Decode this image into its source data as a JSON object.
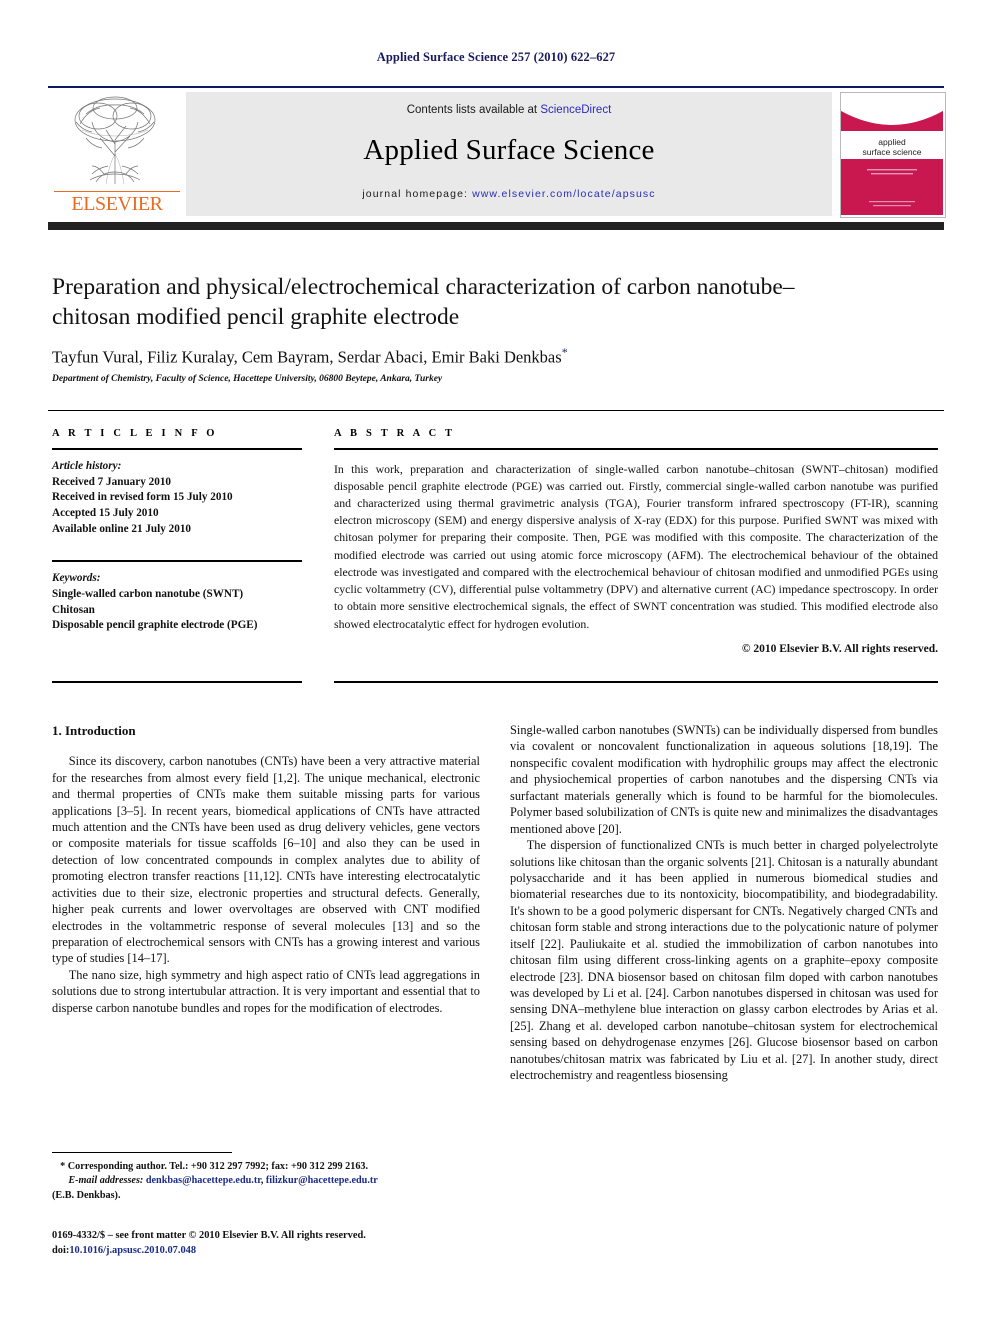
{
  "running_head": "Applied Surface Science 257 (2010) 622–627",
  "masthead": {
    "contents_prefix": "Contents lists available at ",
    "sciencedirect_link": "ScienceDirect",
    "journal_title": "Applied Surface Science",
    "homepage_prefix": "journal homepage:",
    "homepage_url": "www.elsevier.com/locate/apsusc",
    "publisher_wordmark": "ELSEVIER",
    "cover_title_line1": "applied",
    "cover_title_line2": "surface science",
    "colors": {
      "rule_navy": "#0d1b5e",
      "band_grey": "#e9e9e9",
      "link_blue": "#2b2bbb",
      "elsevier_orange": "#ea6a20",
      "cover_magenta": "#c8184f",
      "dark_bar": "#222222"
    }
  },
  "article": {
    "title": "Preparation and physical/electrochemical characterization of carbon nanotube–chitosan modified pencil graphite electrode",
    "authors": "Tayfun Vural, Filiz Kuralay, Cem Bayram, Serdar Abaci, Emir Baki Denkbas",
    "corresponding_marker": "*",
    "affiliation": "Department of Chemistry, Faculty of Science, Hacettepe University, 06800 Beytepe, Ankara, Turkey"
  },
  "article_info": {
    "heading": "A R T I C L E   I N F O",
    "history_label": "Article history:",
    "history": [
      "Received 7 January 2010",
      "Received in revised form 15 July 2010",
      "Accepted 15 July 2010",
      "Available online 21 July 2010"
    ],
    "keywords_label": "Keywords:",
    "keywords": [
      "Single-walled carbon nanotube (SWNT)",
      "Chitosan",
      "Disposable pencil graphite electrode (PGE)"
    ]
  },
  "abstract": {
    "heading": "A B S T R A C T",
    "text": "In this work, preparation and characterization of single-walled carbon nanotube–chitosan (SWNT–chitosan) modified disposable pencil graphite electrode (PGE) was carried out. Firstly, commercial single-walled carbon nanotube was purified and characterized using thermal gravimetric analysis (TGA), Fourier transform infrared spectroscopy (FT-IR), scanning electron microscopy (SEM) and energy dispersive analysis of X-ray (EDX) for this purpose. Purified SWNT was mixed with chitosan polymer for preparing their composite. Then, PGE was modified with this composite. The characterization of the modified electrode was carried out using atomic force microscopy (AFM). The electrochemical behaviour of the obtained electrode was investigated and compared with the electrochemical behaviour of chitosan modified and unmodified PGEs using cyclic voltammetry (CV), differential pulse voltammetry (DPV) and alternative current (AC) impedance spectroscopy. In order to obtain more sensitive electrochemical signals, the effect of SWNT concentration was studied. This modified electrode also showed electrocatalytic effect for hydrogen evolution.",
    "copyright": "© 2010 Elsevier B.V. All rights reserved."
  },
  "body": {
    "section_title": "1. Introduction",
    "left_paragraphs": [
      "Since its discovery, carbon nanotubes (CNTs) have been a very attractive material for the researches from almost every field [1,2]. The unique mechanical, electronic and thermal properties of CNTs make them suitable missing parts for various applications [3–5]. In recent years, biomedical applications of CNTs have attracted much attention and the CNTs have been used as drug delivery vehicles, gene vectors or composite materials for tissue scaffolds [6–10] and also they can be used in detection of low concentrated compounds in complex analytes due to ability of promoting electron transfer reactions [11,12]. CNTs have interesting electrocatalytic activities due to their size, electronic properties and structural defects. Generally, higher peak currents and lower overvoltages are observed with CNT modified electrodes in the voltammetric response of several molecules [13] and so the preparation of electrochemical sensors with CNTs has a growing interest and various type of studies [14–17].",
      "The nano size, high symmetry and high aspect ratio of CNTs lead aggregations in solutions due to strong intertubular attraction. It is very important and essential that to disperse carbon nanotube bundles and ropes for the modification of electrodes."
    ],
    "right_paragraphs": [
      "Single-walled carbon nanotubes (SWNTs) can be individually dispersed from bundles via covalent or noncovalent functionalization in aqueous solutions [18,19]. The nonspecific covalent modification with hydrophilic groups may affect the electronic and physiochemical properties of carbon nanotubes and the dispersing CNTs via surfactant materials generally which is found to be harmful for the biomolecules. Polymer based solubilization of CNTs is quite new and minimalizes the disadvantages mentioned above [20].",
      "The dispersion of functionalized CNTs is much better in charged polyelectrolyte solutions like chitosan than the organic solvents [21]. Chitosan is a naturally abundant polysaccharide and it has been applied in numerous biomedical studies and biomaterial researches due to its nontoxicity, biocompatibility, and biodegradability. It's shown to be a good polymeric dispersant for CNTs. Negatively charged CNTs and chitosan form stable and strong interactions due to the polycationic nature of polymer itself [22]. Pauliukaite et al. studied the immobilization of carbon nanotubes into chitosan film using different cross-linking agents on a graphite–epoxy composite electrode [23]. DNA biosensor based on chitosan film doped with carbon nanotubes was developed by Li et al. [24]. Carbon nanotubes dispersed in chitosan was used for sensing DNA–methylene blue interaction on glassy carbon electrodes by Arias et al. [25]. Zhang et al. developed carbon nanotube–chitosan system for electrochemical sensing based on dehydrogenase enzymes [26]. Glucose biosensor based on carbon nanotubes/chitosan matrix was fabricated by Liu et al. [27]. In another study, direct electrochemistry and reagentless biosensing"
    ]
  },
  "footnote": {
    "corresponding": "* Corresponding author. Tel.: +90 312 297 7992; fax: +90 312 299 2163.",
    "email_label": "E-mail addresses:",
    "email_1": "denkbas@hacettepe.edu.tr",
    "email_2": "filizkur@hacettepe.edu.tr",
    "email_attribution": "(E.B. Denkbas)."
  },
  "imprint": {
    "line1": "0169-4332/$ – see front matter © 2010 Elsevier B.V. All rights reserved.",
    "doi_label": "doi:",
    "doi_value": "10.1016/j.apsusc.2010.07.048"
  }
}
